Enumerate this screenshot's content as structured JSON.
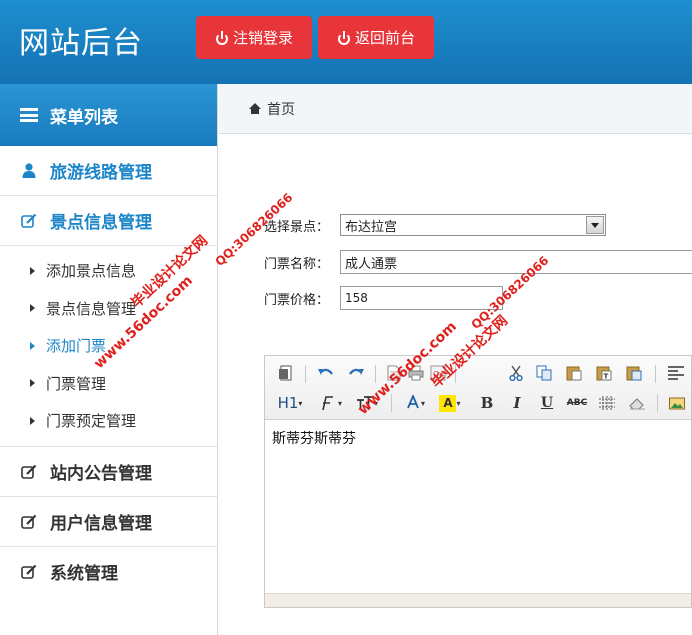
{
  "header": {
    "site_title": "网站后台",
    "logout_label": "注销登录",
    "frontend_label": "返回前台",
    "bg_color": "#1a80c3",
    "button_color": "#e7353a"
  },
  "sidebar": {
    "menu_title": "菜单列表",
    "sections": [
      {
        "label": "旅游线路管理",
        "icon": "user-icon"
      },
      {
        "label": "景点信息管理",
        "icon": "edit-icon"
      },
      {
        "label": "站内公告管理",
        "icon": "edit-icon"
      },
      {
        "label": "用户信息管理",
        "icon": "edit-icon"
      },
      {
        "label": "系统管理",
        "icon": "edit-icon"
      }
    ],
    "sub_items": [
      "添加景点信息",
      "景点信息管理",
      "添加门票",
      "门票管理",
      "门票预定管理"
    ],
    "active_sub": "添加门票"
  },
  "breadcrumb": {
    "home": "首页"
  },
  "form": {
    "scenic_label": "选择景点：",
    "scenic_value": "布达拉宫",
    "ticket_name_label": "门票名称：",
    "ticket_name_value": "成人通票",
    "ticket_price_label": "门票价格：",
    "ticket_price_value": "158"
  },
  "editor": {
    "content": "斯蒂芬斯蒂芬",
    "heading_label": "H1",
    "bold": "B",
    "italic": "I",
    "underline": "U",
    "strike": "ABC"
  },
  "watermarks": {
    "qq": "QQ:306826066",
    "site": "www.56doc.com",
    "name": "毕业设计论文网"
  }
}
